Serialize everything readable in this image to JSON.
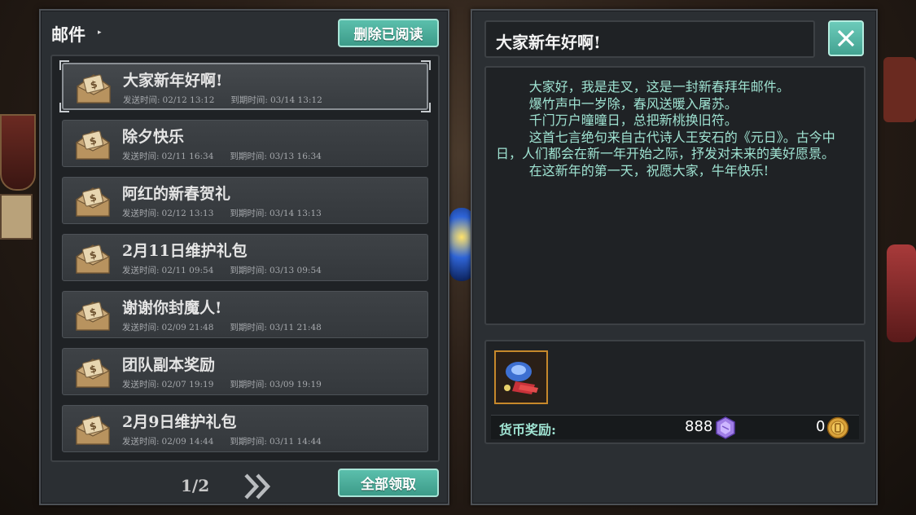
{
  "left_panel": {
    "title": "邮件",
    "delete_read_label": "删除已阅读",
    "claim_all_label": "全部领取",
    "page_indicator": "1/2",
    "mails": [
      {
        "subject": "大家新年好啊!",
        "send_label": "发送时间:",
        "send_time": "02/12 13:12",
        "expire_label": "到期时间:",
        "expire_time": "03/14 13:12",
        "selected": true
      },
      {
        "subject": "除夕快乐",
        "send_label": "发送时间:",
        "send_time": "02/11 16:34",
        "expire_label": "到期时间:",
        "expire_time": "03/13 16:34",
        "selected": false
      },
      {
        "subject": "阿红的新春贺礼",
        "send_label": "发送时间:",
        "send_time": "02/12 13:13",
        "expire_label": "到期时间:",
        "expire_time": "03/14 13:13",
        "selected": false
      },
      {
        "subject": "2月11日维护礼包",
        "send_label": "发送时间:",
        "send_time": "02/11 09:54",
        "expire_label": "到期时间:",
        "expire_time": "03/13 09:54",
        "selected": false
      },
      {
        "subject": "谢谢你封魔人!",
        "send_label": "发送时间:",
        "send_time": "02/09 21:48",
        "expire_label": "到期时间:",
        "expire_time": "03/11 21:48",
        "selected": false
      },
      {
        "subject": "团队副本奖励",
        "send_label": "发送时间:",
        "send_time": "02/07 19:19",
        "expire_label": "到期时间:",
        "expire_time": "03/09 19:19",
        "selected": false
      },
      {
        "subject": "2月9日维护礼包",
        "send_label": "发送时间:",
        "send_time": "02/09 14:44",
        "expire_label": "到期时间:",
        "expire_time": "03/11 14:44",
        "selected": false
      }
    ]
  },
  "right_panel": {
    "subject": "大家新年好啊!",
    "body": "        大家好，我是走叉，这是一封新春拜年邮件。\n        爆竹声中一岁除，春风送暖入屠苏。\n        千门万户曈曈日，总把新桃换旧符。\n        这首七言绝句来自古代诗人王安石的《元日》。古今中日，人们都会在新一年开始之际，抒发对未来的美好愿景。\n        在这新年的第一天，祝愿大家，牛年快乐!",
    "currency_label": "货币奖励:",
    "gem_amount": "888",
    "gold_amount": "0"
  },
  "colors": {
    "accent_teal": "#4fb3a0",
    "body_text": "#9fe3d2",
    "panel_bg": "#2b2f33"
  },
  "icons": {
    "mail": "envelope-icon",
    "next": "double-chevron-right-icon",
    "close": "close-icon",
    "gem": "purple-gem-icon",
    "gold": "gold-coin-icon",
    "item": "reward-item-icon"
  }
}
